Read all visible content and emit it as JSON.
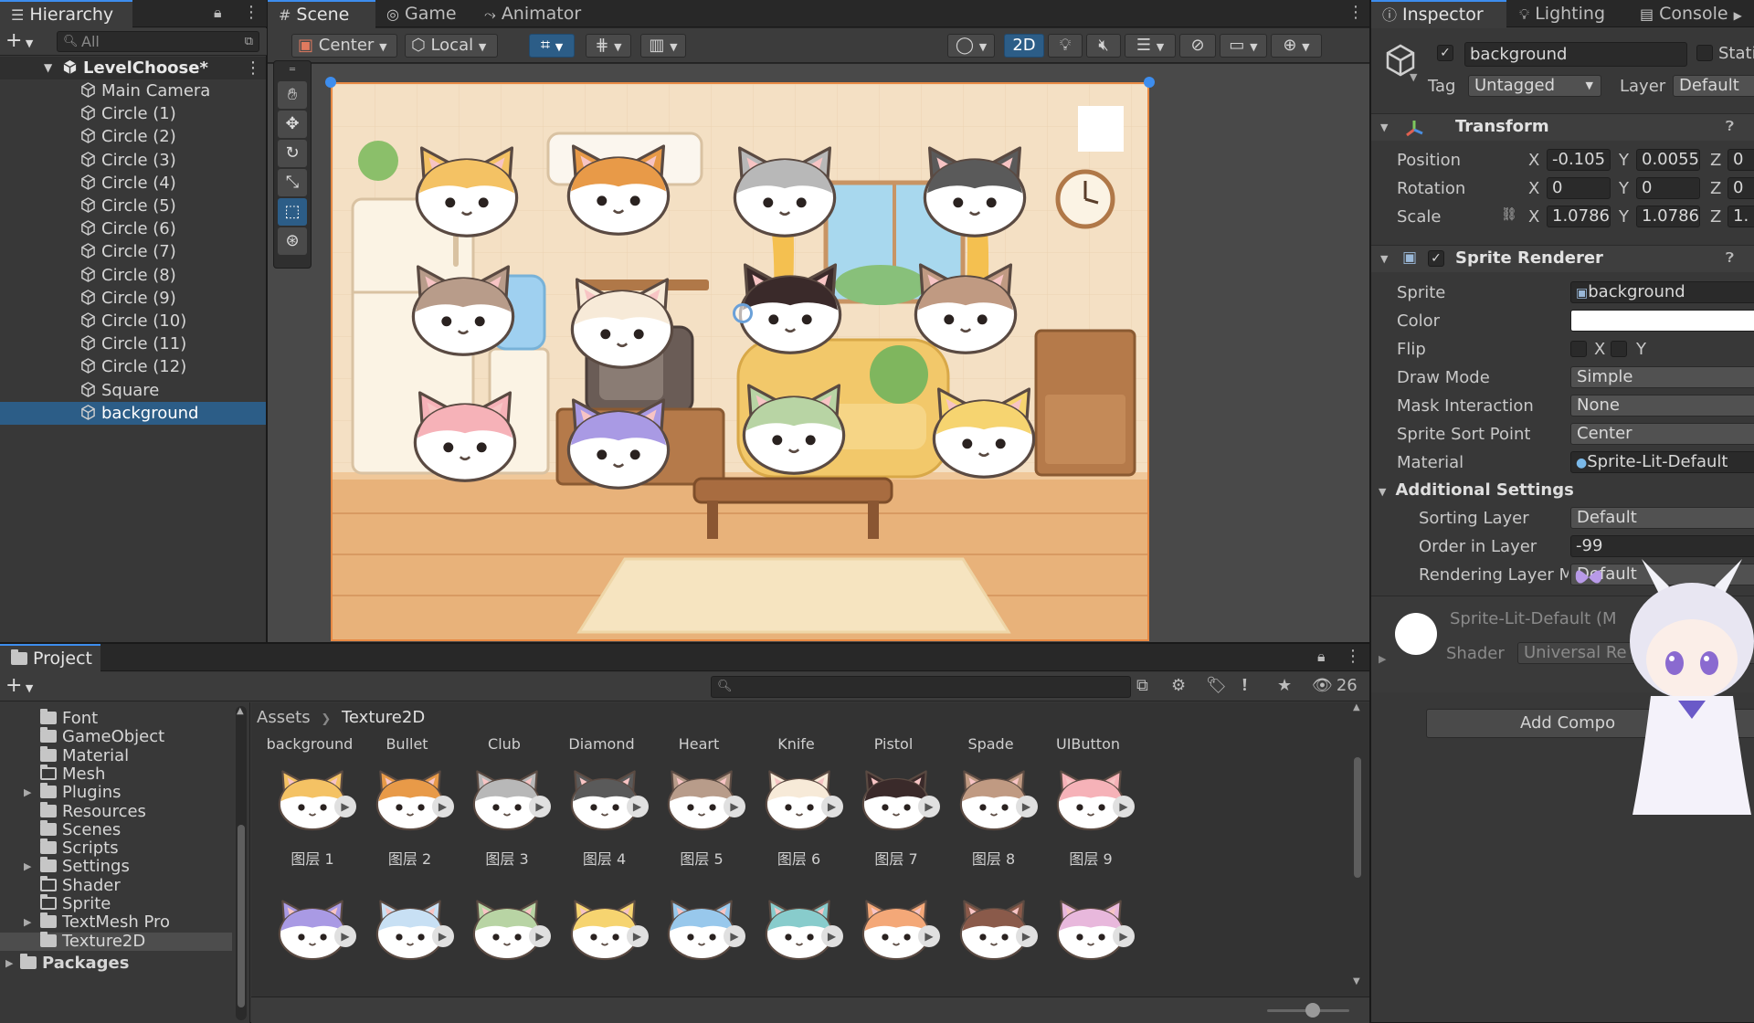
{
  "hierarchy": {
    "tab_label": "Hierarchy",
    "search_placeholder": "All",
    "add_label": "+",
    "root": "LevelChoose*",
    "items": [
      "Main Camera",
      "Circle (1)",
      "Circle (2)",
      "Circle (3)",
      "Circle (4)",
      "Circle (5)",
      "Circle (6)",
      "Circle (7)",
      "Circle (8)",
      "Circle (9)",
      "Circle (10)",
      "Circle (11)",
      "Circle (12)",
      "Square",
      "background"
    ],
    "selected": "background"
  },
  "scene": {
    "tabs": [
      "Scene",
      "Game",
      "Animator"
    ],
    "pivot": "Center",
    "space": "Local",
    "mode_2d": "2D"
  },
  "inspector": {
    "tabs": [
      "Inspector",
      "Lighting",
      "Console"
    ],
    "object_name": "background",
    "static_label": "Stati",
    "tag_label": "Tag",
    "tag_value": "Untagged",
    "layer_label": "Layer",
    "layer_value": "Default",
    "transform": {
      "title": "Transform",
      "position_label": "Position",
      "rotation_label": "Rotation",
      "scale_label": "Scale",
      "position": {
        "x": "-0.105",
        "y": "0.0055",
        "z": "0"
      },
      "rotation": {
        "x": "0",
        "y": "0",
        "z": "0"
      },
      "scale": {
        "x": "1.0786",
        "y": "1.0786",
        "z": "1."
      }
    },
    "sprite_renderer": {
      "title": "Sprite Renderer",
      "sprite_label": "Sprite",
      "sprite_value": "background",
      "color_label": "Color",
      "flip_label": "Flip",
      "flip_x": "X",
      "flip_y": "Y",
      "draw_mode_label": "Draw Mode",
      "draw_mode_value": "Simple",
      "mask_label": "Mask Interaction",
      "mask_value": "None",
      "sort_point_label": "Sprite Sort Point",
      "sort_point_value": "Center",
      "material_label": "Material",
      "material_value": "Sprite-Lit-Default",
      "additional_title": "Additional Settings",
      "sorting_layer_label": "Sorting Layer",
      "sorting_layer_value": "Default",
      "order_label": "Order in Layer",
      "order_value": "-99",
      "rendering_label": "Rendering Layer M",
      "rendering_value": "Default"
    },
    "material_section": {
      "title": "Sprite-Lit-Default (M",
      "shader_label": "Shader",
      "shader_value": "Universal Re"
    },
    "add_component": "Add Compo"
  },
  "project": {
    "tab_label": "Project",
    "folders": [
      "Font",
      "GameObject",
      "Material",
      "Mesh",
      "Plugins",
      "Resources",
      "Scenes",
      "Scripts",
      "Settings",
      "Shader",
      "Sprite",
      "TextMesh Pro",
      "Texture2D"
    ],
    "folders_expandable": [
      "Plugins",
      "Settings",
      "TextMesh Pro"
    ],
    "packages": "Packages",
    "selected_folder": "Texture2D",
    "breadcrumb": [
      "Assets",
      "Texture2D"
    ],
    "hidden_count": "26",
    "header_assets": [
      "background",
      "Bullet",
      "Club",
      "Diamond",
      "Heart",
      "Knife",
      "Pistol",
      "Spade",
      "UIButton"
    ],
    "row1_labels": [
      "图层 1",
      "图层 2",
      "图层 3",
      "图层 4",
      "图层 5",
      "图层 6",
      "图层 7",
      "图层 8",
      "图层 9"
    ],
    "row1_colors": [
      "#f4c264",
      "#e89a48",
      "#b8b8b8",
      "#5a5a5a",
      "#b89c8a",
      "#f7ead8",
      "#3a2a2a",
      "#c09a82",
      "#f6b2b8"
    ],
    "row2_colors": [
      "#a99ae4",
      "#c8e0f4",
      "#b8d4a4",
      "#f6d470",
      "#98c8ec",
      "#88cccc",
      "#f4a878",
      "#8a5a4a",
      "#e8b8dc"
    ]
  },
  "colors": {
    "accent": "#3d8dee",
    "selection": "#2c5d87",
    "panel": "#383838",
    "scene_bg": "#f4e0c4"
  }
}
